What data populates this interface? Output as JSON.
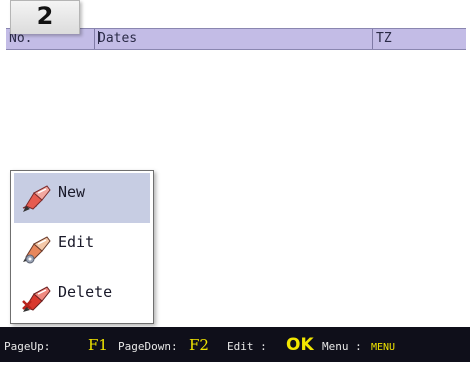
{
  "badge": {
    "number": "2"
  },
  "header": {
    "columns": [
      {
        "label": "No."
      },
      {
        "label": "Dates"
      },
      {
        "label": "TZ"
      }
    ]
  },
  "menu": {
    "items": [
      {
        "label": "New",
        "icon": "new-pencil-icon",
        "selected": true
      },
      {
        "label": "Edit",
        "icon": "edit-pencil-icon",
        "selected": false
      },
      {
        "label": "Delete",
        "icon": "delete-pencil-icon",
        "selected": false
      }
    ]
  },
  "footer": {
    "keys": [
      {
        "label": "PageUp:",
        "key": "F1"
      },
      {
        "label": "PageDown:",
        "key": "F2"
      },
      {
        "label": "Edit :",
        "key": "OK"
      },
      {
        "label": "Menu :",
        "key": "MENU"
      }
    ]
  },
  "colors": {
    "header_bg": "#c3bce6",
    "selected_bg": "#c7cde3",
    "footer_bg": "#0f0f1a",
    "key_color": "#f2e600"
  }
}
